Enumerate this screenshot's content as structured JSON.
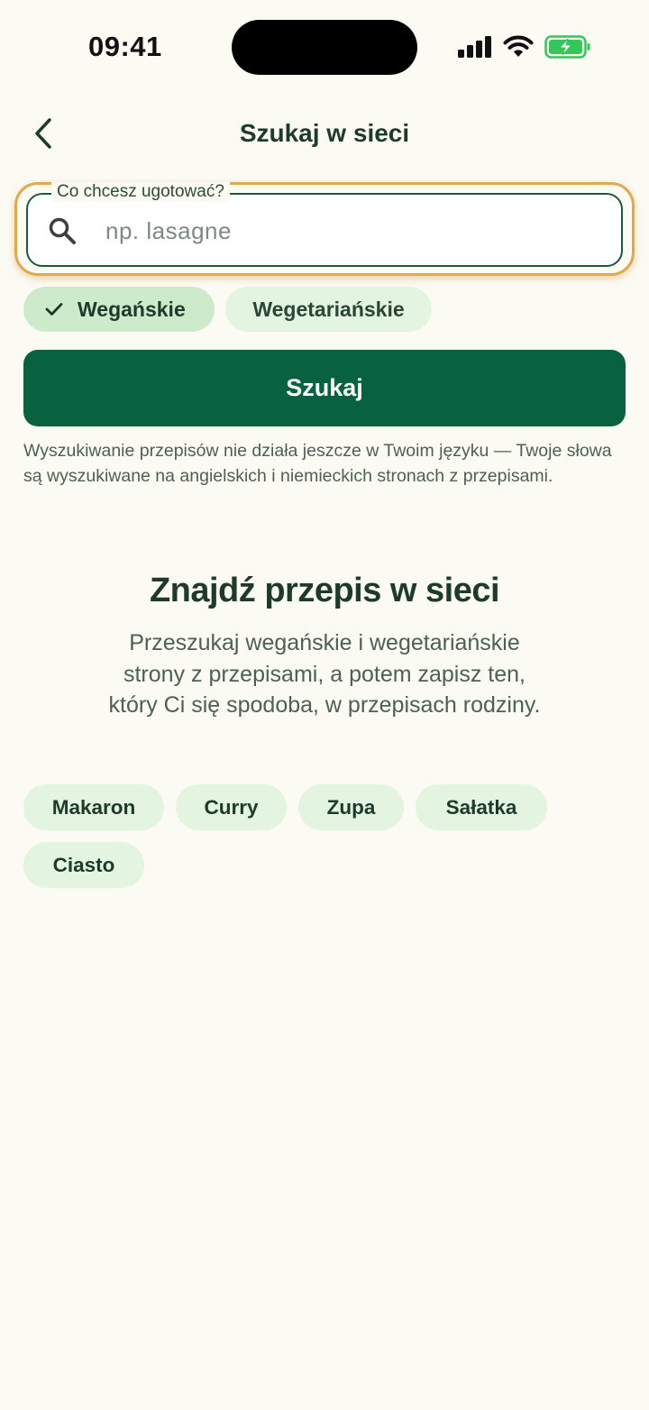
{
  "status_bar": {
    "time": "09:41",
    "icons": [
      "signal-icon",
      "wifi-icon",
      "battery-charging-icon"
    ]
  },
  "header": {
    "back_icon": "chevron-left-icon",
    "title": "Szukaj w sieci"
  },
  "search": {
    "label": "Co chcesz ugotować?",
    "placeholder": "np. lasagne",
    "value": "",
    "icon": "search-icon"
  },
  "filters": [
    {
      "label": "Wegańskie",
      "selected": true
    },
    {
      "label": "Wegetariańskie",
      "selected": false
    }
  ],
  "search_button_label": "Szukaj",
  "notice": "Wyszukiwanie przepisów nie działa jeszcze w Twoim języku — Twoje słowa są wyszukiwane na angielskich i niemieckich stronach z przepisami.",
  "empty_state": {
    "title": "Znajdź przepis w sieci",
    "description": "Przeszukaj wegańskie i wegetariańskie strony z przepisami, a potem zapisz ten, który Ci się spodoba, w przepisach rodziny."
  },
  "suggestions": [
    "Makaron",
    "Curry",
    "Zupa",
    "Sałatka",
    "Ciasto"
  ],
  "colors": {
    "background": "#FBFAF3",
    "primary": "#08613F",
    "chip_selected": "#CDEBCB",
    "chip": "#E3F4E0",
    "focus_ring": "#E0A94B",
    "battery": "#34C759"
  }
}
